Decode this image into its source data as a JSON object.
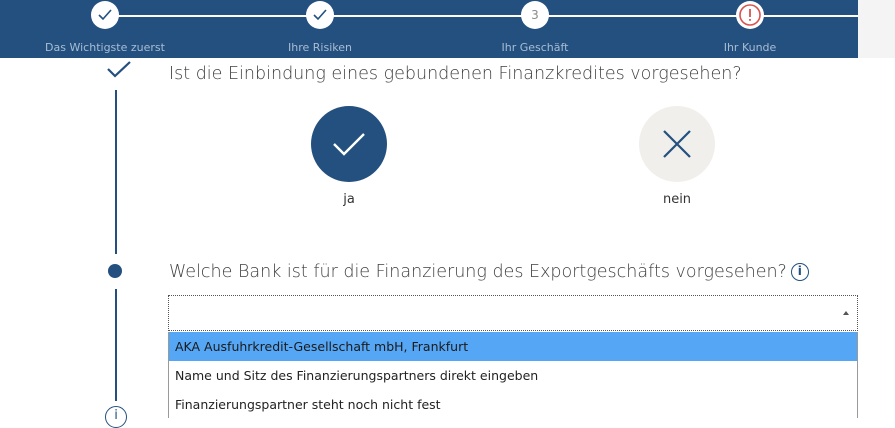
{
  "stepper": {
    "steps": [
      {
        "label": "Das Wichtigste zuerst",
        "state": "done",
        "number": ""
      },
      {
        "label": "Ihre Risiken",
        "state": "done",
        "number": ""
      },
      {
        "label": "Ihr Geschäft",
        "state": "pending",
        "number": "3"
      },
      {
        "label": "Ihr Kunde",
        "state": "error",
        "number": ""
      }
    ]
  },
  "questions": {
    "financing_question": "Ist die Einbindung eines gebundenen Finanzkredites vorgesehen?",
    "bank_question": "Welche Bank ist für die Finanzierung des Exportgeschäfts vorgesehen?"
  },
  "options": {
    "yes_label": "ja",
    "no_label": "nein",
    "selected": "ja"
  },
  "bank_select": {
    "value": "",
    "options": [
      "AKA Ausfuhrkredit-Gesellschaft mbH, Frankfurt",
      "Name und Sitz des Finanzierungspartners direkt eingeben",
      "Finanzierungspartner steht noch nicht fest"
    ],
    "highlighted_index": 0
  },
  "colors": {
    "primary": "#23507f",
    "highlight": "#55a7f5",
    "error": "#d9534f"
  }
}
